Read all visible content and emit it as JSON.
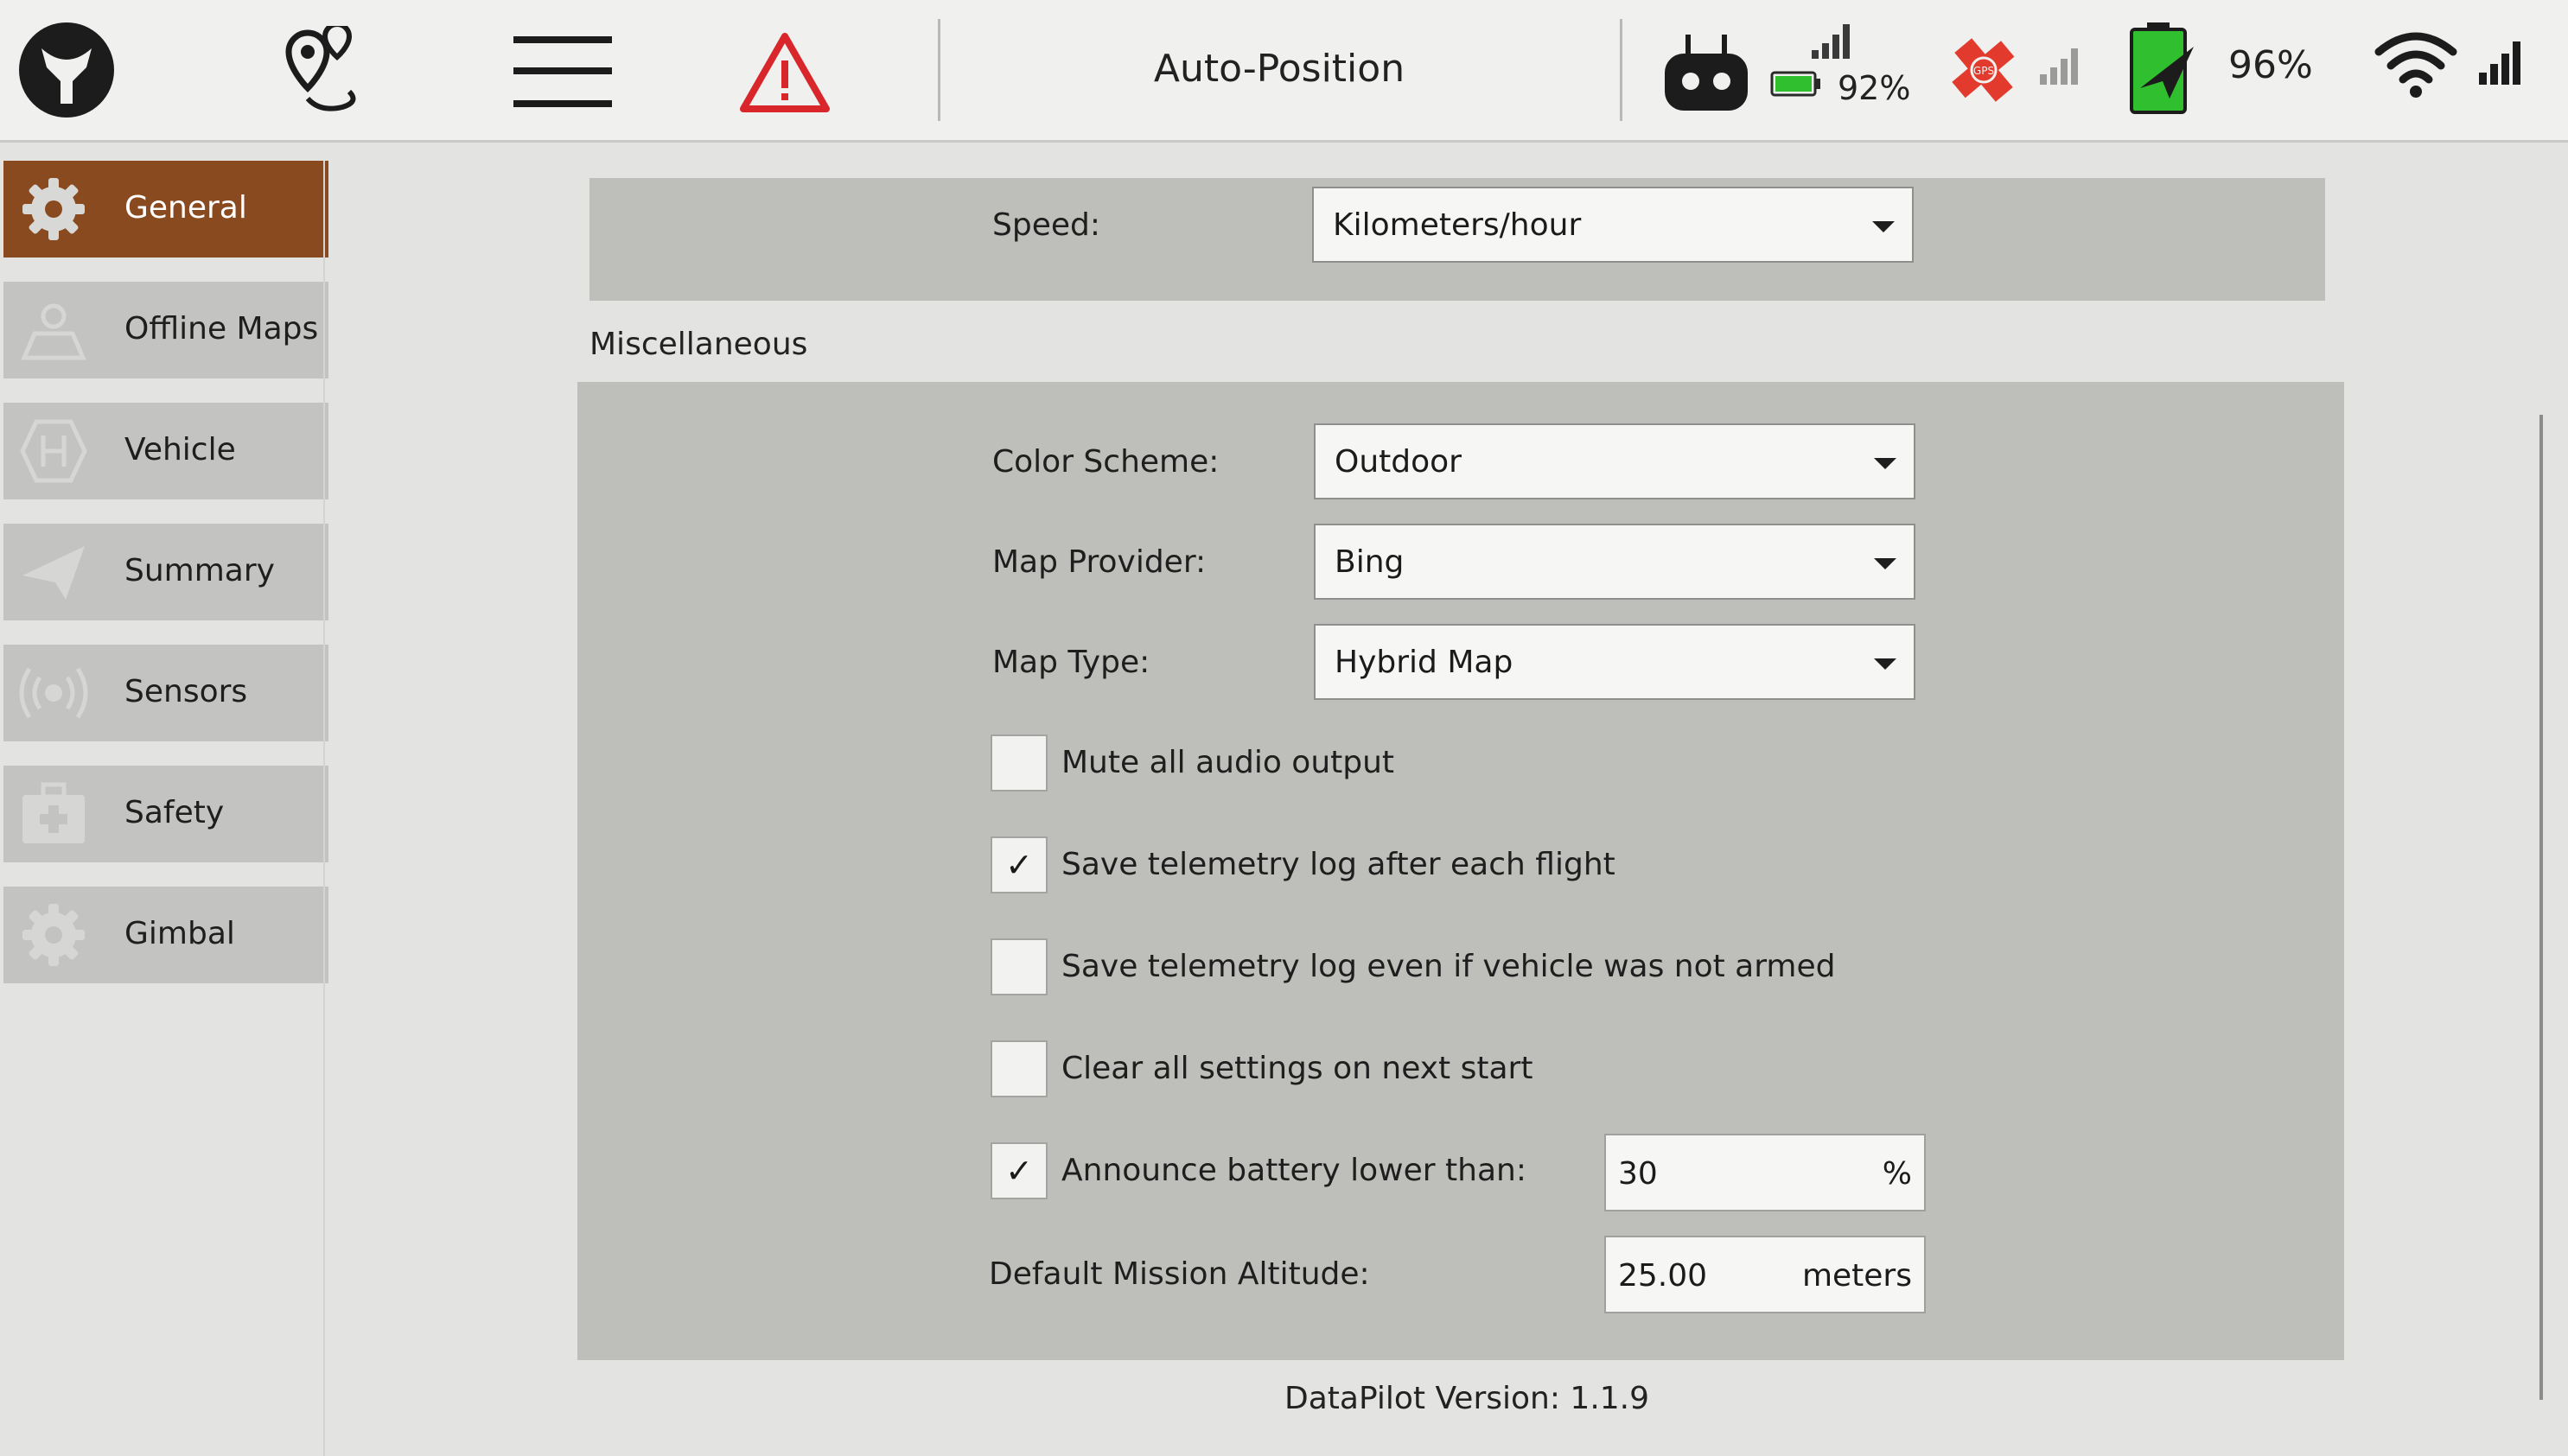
{
  "topbar": {
    "title": "Auto-Position",
    "rc_battery": "92%",
    "vehicle_battery": "96%",
    "gps_badge": "GPS",
    "icons": [
      "app-logo-icon",
      "plan-view-icon",
      "menu-icon",
      "alert-icon",
      "remote-controller-icon",
      "rc-signal-icon",
      "rc-battery-icon",
      "gps-off-icon",
      "gps-signal-icon",
      "vehicle-battery-icon",
      "wifi-icon",
      "telemetry-signal-icon"
    ]
  },
  "sidebar": {
    "items": [
      {
        "label": "General",
        "icon": "gear-icon",
        "active": true
      },
      {
        "label": "Offline Maps",
        "icon": "map-person-icon",
        "active": false
      },
      {
        "label": "Vehicle",
        "icon": "vehicle-icon",
        "active": false
      },
      {
        "label": "Summary",
        "icon": "paper-plane-icon",
        "active": false
      },
      {
        "label": "Sensors",
        "icon": "sensor-icon",
        "active": false
      },
      {
        "label": "Safety",
        "icon": "first-aid-icon",
        "active": false
      },
      {
        "label": "Gimbal",
        "icon": "gimbal-gear-icon",
        "active": false
      }
    ]
  },
  "units": {
    "speed_label": "Speed:",
    "speed_value": "Kilometers/hour"
  },
  "misc": {
    "header": "Miscellaneous",
    "color_scheme_label": "Color Scheme:",
    "color_scheme_value": "Outdoor",
    "map_provider_label": "Map Provider:",
    "map_provider_value": "Bing",
    "map_type_label": "Map Type:",
    "map_type_value": "Hybrid Map",
    "checkboxes": [
      {
        "label": "Mute all audio output",
        "checked": false
      },
      {
        "label": "Save telemetry log after each flight",
        "checked": true
      },
      {
        "label": "Save telemetry log even if vehicle was not armed",
        "checked": false
      },
      {
        "label": "Clear all settings on next start",
        "checked": false
      },
      {
        "label": "Announce battery lower than:",
        "checked": true
      }
    ],
    "check_mark": "✓",
    "battery_threshold": "30",
    "battery_unit": "%",
    "altitude_label": "Default Mission Altitude:",
    "altitude_value": "25.00",
    "altitude_unit": "meters"
  },
  "footer": {
    "version": "DataPilot Version: 1.1.9"
  },
  "colors": {
    "active_sidebar": "#8a4a20",
    "panel": "#bebebb",
    "gps_error": "#e23b2e",
    "battery_green": "#2fbf2f",
    "alert_red": "#d9262b"
  }
}
